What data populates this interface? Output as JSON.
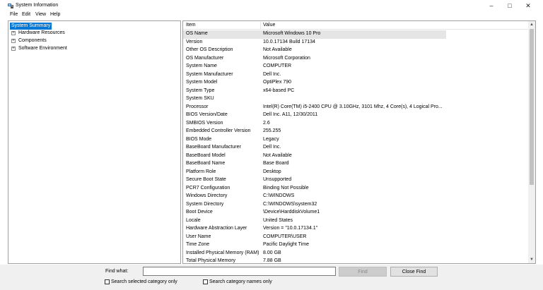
{
  "window": {
    "title": "System Information",
    "minimize_glyph": "–",
    "maximize_glyph": "□",
    "close_glyph": "✕",
    "app_icon": "system-information-icon"
  },
  "menu": {
    "items": [
      "File",
      "Edit",
      "View",
      "Help"
    ]
  },
  "tree": {
    "root": "System Summary",
    "nodes": [
      {
        "label": "Hardware Resources",
        "expander": "+"
      },
      {
        "label": "Components",
        "expander": "+"
      },
      {
        "label": "Software Environment",
        "expander": "+"
      }
    ]
  },
  "list": {
    "columns": [
      "Item",
      "Value"
    ],
    "rows": [
      {
        "item": "OS Name",
        "value": "Microsoft Windows 10 Pro"
      },
      {
        "item": "Version",
        "value": "10.0.17134 Build 17134"
      },
      {
        "item": "Other OS Description",
        "value": "Not Available"
      },
      {
        "item": "OS Manufacturer",
        "value": "Microsoft Corporation"
      },
      {
        "item": "System Name",
        "value": "COMPUTER"
      },
      {
        "item": "System Manufacturer",
        "value": "Dell Inc."
      },
      {
        "item": "System Model",
        "value": "OptiPlex 790"
      },
      {
        "item": "System Type",
        "value": "x64-based PC"
      },
      {
        "item": "System SKU",
        "value": ""
      },
      {
        "item": "Processor",
        "value": "Intel(R) Core(TM) i5-2400 CPU @ 3.10GHz, 3101 Mhz, 4 Core(s), 4 Logical Pro..."
      },
      {
        "item": "BIOS Version/Date",
        "value": "Dell Inc. A11, 12/30/2011"
      },
      {
        "item": "SMBIOS Version",
        "value": "2.6"
      },
      {
        "item": "Embedded Controller Version",
        "value": "255.255"
      },
      {
        "item": "BIOS Mode",
        "value": "Legacy"
      },
      {
        "item": "BaseBoard Manufacturer",
        "value": "Dell Inc."
      },
      {
        "item": "BaseBoard Model",
        "value": "Not Available"
      },
      {
        "item": "BaseBoard Name",
        "value": "Base Board"
      },
      {
        "item": "Platform Role",
        "value": "Desktop"
      },
      {
        "item": "Secure Boot State",
        "value": "Unsupported"
      },
      {
        "item": "PCR7 Configuration",
        "value": "Binding Not Possible"
      },
      {
        "item": "Windows Directory",
        "value": "C:\\WINDOWS"
      },
      {
        "item": "System Directory",
        "value": "C:\\WINDOWS\\system32"
      },
      {
        "item": "Boot Device",
        "value": "\\Device\\HarddiskVolume1"
      },
      {
        "item": "Locale",
        "value": "United States"
      },
      {
        "item": "Hardware Abstraction Layer",
        "value": "Version = \"10.0.17134.1\""
      },
      {
        "item": "User Name",
        "value": "COMPUTER\\USER"
      },
      {
        "item": "Time Zone",
        "value": "Pacific Daylight Time"
      },
      {
        "item": "Installed Physical Memory (RAM)",
        "value": "8.00 GB"
      },
      {
        "item": "Total Physical Memory",
        "value": "7.88 GB"
      }
    ]
  },
  "scrollbar": {
    "up_glyph": "▲",
    "down_glyph": "▼"
  },
  "find": {
    "label": "Find what:",
    "input_value": "",
    "find_button": "Find",
    "close_button": "Close Find",
    "check_selected": "Search selected category only",
    "check_names": "Search category names only"
  },
  "colors": {
    "selection": "#0078d7",
    "row_highlight": "#e5e5e5",
    "findbar_bg": "#f0f0f0"
  }
}
